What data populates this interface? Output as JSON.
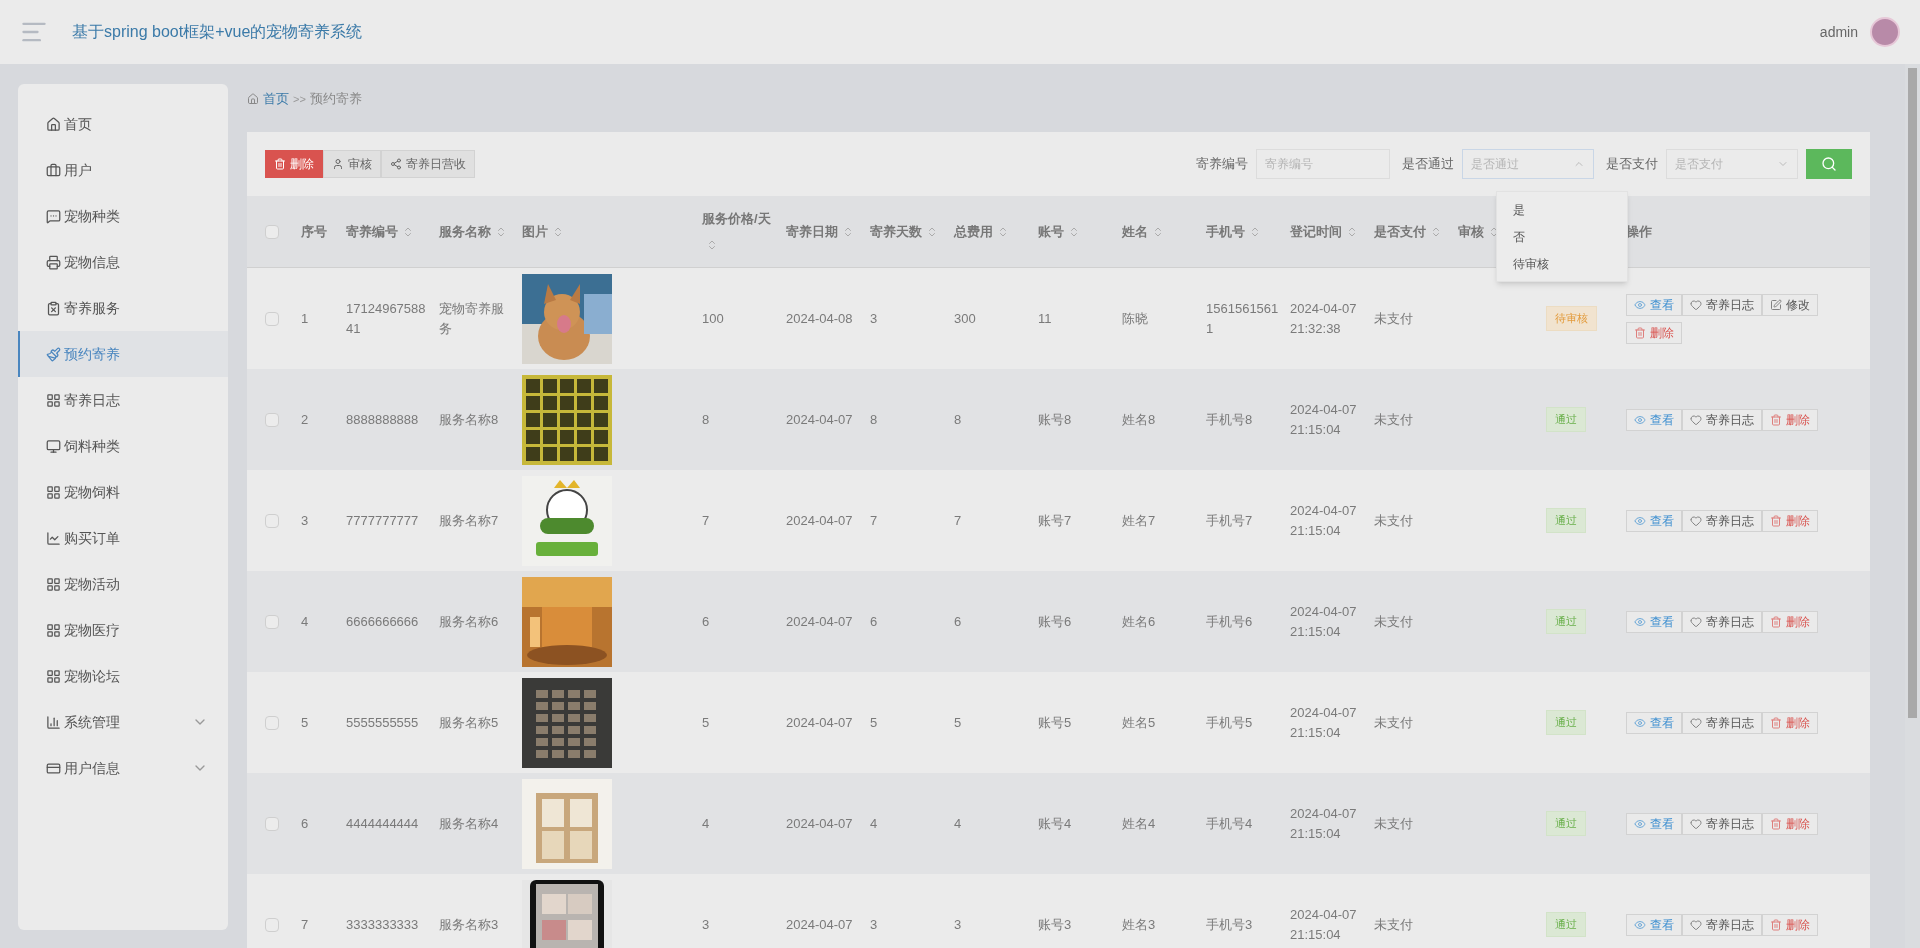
{
  "header": {
    "title": "基于spring boot框架+vue的宠物寄养系统",
    "user": "admin"
  },
  "sidebar": {
    "items": [
      {
        "label": "首页",
        "selected": false
      },
      {
        "label": "用户",
        "selected": false
      },
      {
        "label": "宠物种类",
        "selected": false
      },
      {
        "label": "宠物信息",
        "selected": false
      },
      {
        "label": "寄养服务",
        "selected": false
      },
      {
        "label": "预约寄养",
        "selected": true
      },
      {
        "label": "寄养日志",
        "selected": false
      },
      {
        "label": "饲料种类",
        "selected": false
      },
      {
        "label": "宠物饲料",
        "selected": false
      },
      {
        "label": "购买订单",
        "selected": false
      },
      {
        "label": "宠物活动",
        "selected": false
      },
      {
        "label": "宠物医疗",
        "selected": false
      },
      {
        "label": "宠物论坛",
        "selected": false
      },
      {
        "label": "系统管理",
        "selected": false,
        "expanded": false
      },
      {
        "label": "用户信息",
        "selected": false,
        "expanded": false
      }
    ]
  },
  "breadcrumb": [
    {
      "label": "首页"
    },
    {
      "label": ">>"
    },
    {
      "label": "预约寄养"
    }
  ],
  "toolbar": [
    {
      "label": "删除",
      "kind": "danger"
    },
    {
      "label": "审核",
      "kind": "user"
    },
    {
      "label": "寄养日营收",
      "kind": "share"
    }
  ],
  "search": {
    "fields": [
      {
        "label": "寄养编号",
        "placeholder": "寄养编号",
        "kind": "input"
      },
      {
        "label": "是否通过",
        "placeholder": "是否通过",
        "kind": "select",
        "open": true,
        "options": [
          "是",
          "否",
          "待审核"
        ]
      },
      {
        "label": "是否支付",
        "placeholder": "是否支付",
        "kind": "select",
        "open": false
      }
    ]
  },
  "table": {
    "header_checked": false,
    "columns": [
      {
        "label": "序号",
        "sortable": false
      },
      {
        "label": "寄养编号",
        "sortable": true
      },
      {
        "label": "服务名称",
        "sortable": true
      },
      {
        "label": "图片",
        "sortable": true
      },
      {
        "label": "服务价格/天",
        "sortable": true
      },
      {
        "label": "寄养日期",
        "sortable": true
      },
      {
        "label": "寄养天数",
        "sortable": true
      },
      {
        "label": "总费用",
        "sortable": true
      },
      {
        "label": "账号",
        "sortable": true
      },
      {
        "label": "姓名",
        "sortable": true
      },
      {
        "label": "手机号",
        "sortable": true
      },
      {
        "label": "登记时间",
        "sortable": true
      },
      {
        "label": "是否支付",
        "sortable": true
      },
      {
        "label": "审核",
        "sortable": true
      },
      {},
      {
        "label": "操作",
        "sortable": false
      }
    ],
    "rows": [
      {
        "checked": false,
        "cells": [
          "1",
          "1712496758841",
          "宠物寄养服务",
          {
            "kind": "picture"
          },
          "100",
          "2024-04-08",
          "3",
          "300",
          "11",
          "陈晓",
          "15615615611",
          "2024-04-07 21:32:38",
          "未支付",
          "",
          {
            "kind": "status",
            "text": "待审核",
            "passed": false
          },
          {
            "kind": "actions",
            "items": [
              {
                "label": "查看",
                "kind": "view"
              },
              {
                "label": "寄养日志",
                "kind": "log"
              },
              {
                "label": "修改",
                "kind": "edit"
              },
              {
                "label": "删除",
                "kind": "delete"
              }
            ]
          }
        ]
      },
      {
        "checked": false,
        "cells": [
          "2",
          "8888888888",
          "服务名称8",
          {
            "kind": "picture"
          },
          "8",
          "2024-04-07",
          "8",
          "8",
          "账号8",
          "姓名8",
          "手机号8",
          "2024-04-07 21:15:04",
          "未支付",
          "",
          {
            "kind": "status",
            "text": "通过",
            "passed": true
          },
          {
            "kind": "actions",
            "items": [
              {
                "label": "查看",
                "kind": "view"
              },
              {
                "label": "寄养日志",
                "kind": "log"
              },
              {
                "label": "删除",
                "kind": "delete"
              }
            ]
          }
        ]
      },
      {
        "checked": false,
        "cells": [
          "3",
          "7777777777",
          "服务名称7",
          {
            "kind": "picture"
          },
          "7",
          "2024-04-07",
          "7",
          "7",
          "账号7",
          "姓名7",
          "手机号7",
          "2024-04-07 21:15:04",
          "未支付",
          "",
          {
            "kind": "status",
            "text": "通过",
            "passed": true
          },
          {
            "kind": "actions",
            "items": [
              {
                "label": "查看",
                "kind": "view"
              },
              {
                "label": "寄养日志",
                "kind": "log"
              },
              {
                "label": "删除",
                "kind": "delete"
              }
            ]
          }
        ]
      },
      {
        "checked": false,
        "cells": [
          "4",
          "6666666666",
          "服务名称6",
          {
            "kind": "picture"
          },
          "6",
          "2024-04-07",
          "6",
          "6",
          "账号6",
          "姓名6",
          "手机号6",
          "2024-04-07 21:15:04",
          "未支付",
          "",
          {
            "kind": "status",
            "text": "通过",
            "passed": true
          },
          {
            "kind": "actions",
            "items": [
              {
                "label": "查看",
                "kind": "view"
              },
              {
                "label": "寄养日志",
                "kind": "log"
              },
              {
                "label": "删除",
                "kind": "delete"
              }
            ]
          }
        ]
      },
      {
        "checked": false,
        "cells": [
          "5",
          "5555555555",
          "服务名称5",
          {
            "kind": "picture"
          },
          "5",
          "2024-04-07",
          "5",
          "5",
          "账号5",
          "姓名5",
          "手机号5",
          "2024-04-07 21:15:04",
          "未支付",
          "",
          {
            "kind": "status",
            "text": "通过",
            "passed": true
          },
          {
            "kind": "actions",
            "items": [
              {
                "label": "查看",
                "kind": "view"
              },
              {
                "label": "寄养日志",
                "kind": "log"
              },
              {
                "label": "删除",
                "kind": "delete"
              }
            ]
          }
        ]
      },
      {
        "checked": false,
        "cells": [
          "6",
          "4444444444",
          "服务名称4",
          {
            "kind": "picture"
          },
          "4",
          "2024-04-07",
          "4",
          "4",
          "账号4",
          "姓名4",
          "手机号4",
          "2024-04-07 21:15:04",
          "未支付",
          "",
          {
            "kind": "status",
            "text": "通过",
            "passed": true
          },
          {
            "kind": "actions",
            "items": [
              {
                "label": "查看",
                "kind": "view"
              },
              {
                "label": "寄养日志",
                "kind": "log"
              },
              {
                "label": "删除",
                "kind": "delete"
              }
            ]
          }
        ]
      },
      {
        "checked": false,
        "cells": [
          "7",
          "3333333333",
          "服务名称3",
          {
            "kind": "picture"
          },
          "3",
          "2024-04-07",
          "3",
          "3",
          "账号3",
          "姓名3",
          "手机号3",
          "2024-04-07 21:15:04",
          "未支付",
          "",
          {
            "kind": "status",
            "text": "通过",
            "passed": true
          },
          {
            "kind": "actions",
            "items": [
              {
                "label": "查看",
                "kind": "view"
              },
              {
                "label": "寄养日志",
                "kind": "log"
              },
              {
                "label": "删除",
                "kind": "delete"
              }
            ]
          }
        ]
      }
    ]
  }
}
